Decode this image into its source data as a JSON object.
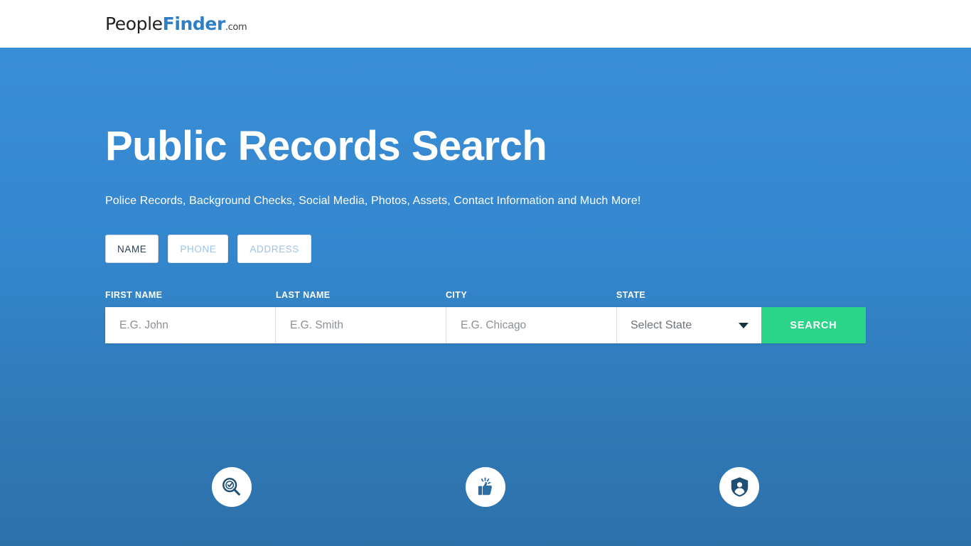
{
  "header": {
    "logo": {
      "part1": "People",
      "part2": "Finder",
      "part3": ".com",
      "color_part2": "#2f7fc4"
    }
  },
  "hero": {
    "title": "Public Records Search",
    "subtitle": "Police Records, Background Checks, Social Media, Photos, Assets, Contact Information and Much More!",
    "background_top_color": "#3a8ed6",
    "background_bottom_color": "#2d71ab"
  },
  "tabs": [
    {
      "label": "NAME",
      "active": true
    },
    {
      "label": "PHONE",
      "active": false
    },
    {
      "label": "ADDRESS",
      "active": false
    }
  ],
  "search_form": {
    "labels": [
      "FIRST NAME",
      "LAST NAME",
      "CITY",
      "STATE"
    ],
    "fields": [
      {
        "name": "first-name",
        "placeholder": "E.G. John",
        "value": ""
      },
      {
        "name": "last-name",
        "placeholder": "E.G. Smith",
        "value": ""
      },
      {
        "name": "city",
        "placeholder": "E.G. Chicago",
        "value": ""
      }
    ],
    "state_select": {
      "selected": "Select State",
      "icon": "chevron-down-icon"
    },
    "submit": {
      "label": "SEARCH",
      "color": "#2bd488"
    }
  },
  "features": [
    {
      "icon": "search-check-icon"
    },
    {
      "icon": "thumbs-up-icon"
    },
    {
      "icon": "shield-person-icon"
    }
  ]
}
